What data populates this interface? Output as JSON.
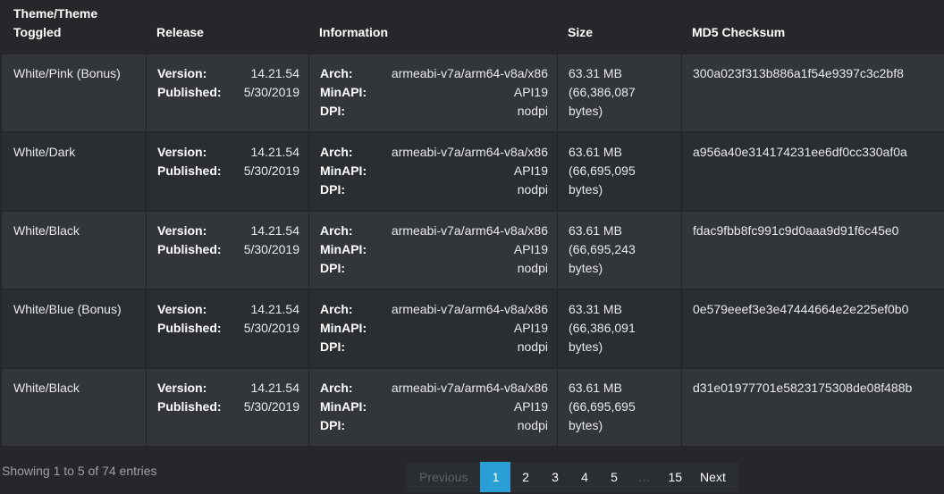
{
  "headers": {
    "theme": "Theme/Theme\nToggled",
    "theme_line1": "Theme/Theme",
    "theme_line2": "Toggled",
    "release": "Release",
    "information": "Information",
    "size": "Size",
    "md5": "MD5 Checksum"
  },
  "labels": {
    "version": "Version:",
    "published": "Published:",
    "arch": "Arch:",
    "minapi": "MinAPI:",
    "dpi": "DPI:"
  },
  "rows": [
    {
      "theme": "White/Pink (Bonus)",
      "version": "14.21.54",
      "published": "5/30/2019",
      "arch": "armeabi-v7a/arm64-v8a/x86",
      "minapi": "API19",
      "dpi": "nodpi",
      "size1": "63.31 MB",
      "size2": "(66,386,087",
      "size3": "bytes)",
      "md5": "300a023f313b886a1f54e9397c3c2bf8"
    },
    {
      "theme": "White/Dark",
      "version": "14.21.54",
      "published": "5/30/2019",
      "arch": "armeabi-v7a/arm64-v8a/x86",
      "minapi": "API19",
      "dpi": "nodpi",
      "size1": "63.61 MB",
      "size2": "(66,695,095",
      "size3": "bytes)",
      "md5": "a956a40e314174231ee6df0cc330af0a"
    },
    {
      "theme": "White/Black",
      "version": "14.21.54",
      "published": "5/30/2019",
      "arch": "armeabi-v7a/arm64-v8a/x86",
      "minapi": "API19",
      "dpi": "nodpi",
      "size1": "63.61 MB",
      "size2": "(66,695,243",
      "size3": "bytes)",
      "md5": "fdac9fbb8fc991c9d0aaa9d91f6c45e0"
    },
    {
      "theme": "White/Blue (Bonus)",
      "version": "14.21.54",
      "published": "5/30/2019",
      "arch": "armeabi-v7a/arm64-v8a/x86",
      "minapi": "API19",
      "dpi": "nodpi",
      "size1": "63.31 MB",
      "size2": "(66,386,091",
      "size3": "bytes)",
      "md5": "0e579eeef3e3e47444664e2e225ef0b0"
    },
    {
      "theme": "White/Black",
      "version": "14.21.54",
      "published": "5/30/2019",
      "arch": "armeabi-v7a/arm64-v8a/x86",
      "minapi": "API19",
      "dpi": "nodpi",
      "size1": "63.61 MB",
      "size2": "(66,695,695",
      "size3": "bytes)",
      "md5": "d31e01977701e5823175308de08f488b"
    }
  ],
  "footer": {
    "info": "Showing 1 to 5 of 74 entries"
  },
  "pagination": {
    "previous": "Previous",
    "pages": [
      "1",
      "2",
      "3",
      "4",
      "5"
    ],
    "ellipsis": "…",
    "last": "15",
    "next": "Next",
    "active_page": "1"
  },
  "colors": {
    "background": "#25272b",
    "row_light": "#32353a",
    "row_dark": "#2a2d31",
    "accent": "#2a9fd6"
  }
}
